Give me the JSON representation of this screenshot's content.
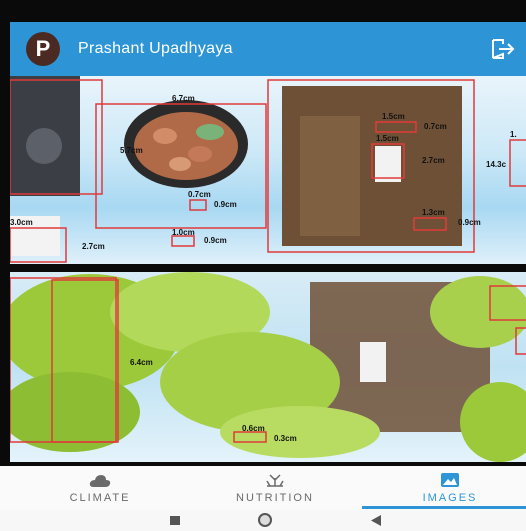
{
  "header": {
    "avatar_letter": "P",
    "user_name": "Prashant Upadhyaya",
    "logout_icon": "logout-icon"
  },
  "photo_top": {
    "labels": [
      "6.7cm",
      "5.7cm",
      "3.0cm",
      "2.7cm",
      "0.7cm",
      "0.9cm",
      "1.0cm",
      "0.9cm",
      "1.5cm",
      "0.7cm",
      "1.5cm",
      "2.7cm",
      "1.3cm",
      "0.9cm",
      "1.",
      "14.3c"
    ]
  },
  "photo_bottom": {
    "labels": [
      "6.4cm",
      "0.6cm",
      "0.3cm"
    ]
  },
  "tabs": [
    {
      "label": "CLIMATE",
      "icon": "cloud-icon",
      "active": false
    },
    {
      "label": "NUTRITION",
      "icon": "sprout-icon",
      "active": false
    },
    {
      "label": "IMAGES",
      "icon": "image-icon",
      "active": true
    }
  ],
  "colors": {
    "accent": "#2d95d6",
    "box": "#e03a3a",
    "avatar": "#4a2a22"
  }
}
